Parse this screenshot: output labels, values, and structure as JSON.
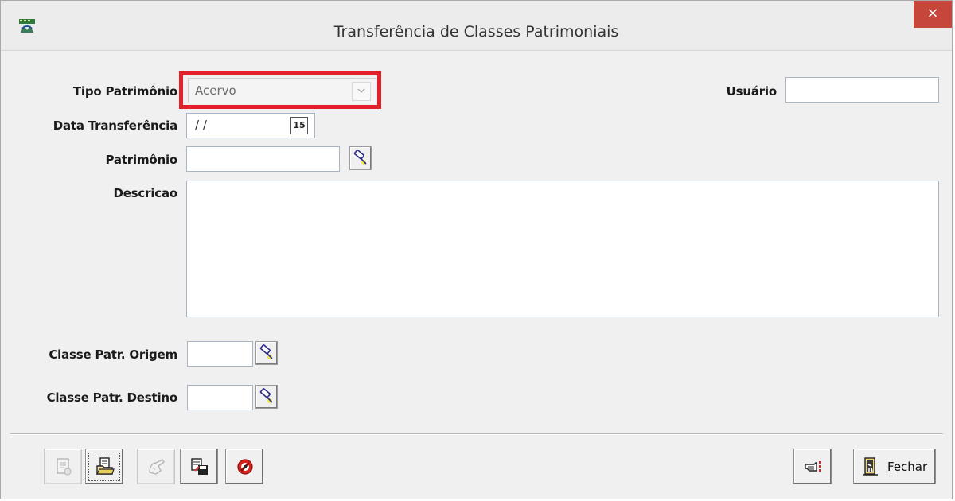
{
  "window": {
    "title": "Transferência de Classes Patrimoniais",
    "close_glyph": "×"
  },
  "form": {
    "tipo_patrimonio": {
      "label": "Tipo Patrimônio",
      "value": "Acervo"
    },
    "usuario": {
      "label": "Usuário",
      "value": ""
    },
    "data_transferencia": {
      "label": "Data Transferência",
      "value": "/ /"
    },
    "patrimonio": {
      "label": "Patrimônio",
      "value": ""
    },
    "descricao": {
      "label": "Descricao",
      "value": ""
    },
    "classe_origem": {
      "label": "Classe Patr. Origem",
      "value": ""
    },
    "classe_destino": {
      "label": "Classe Patr. Destino",
      "value": ""
    }
  },
  "toolbar": {
    "calendar_day": "15",
    "fechar_first": "F",
    "fechar_rest": "echar"
  },
  "icons": {
    "app": "app-logo-icon",
    "search": "flashlight-search-icon",
    "calendar": "calendar-icon",
    "new": "new-document-icon",
    "open": "folder-document-icon",
    "edit": "edit-hand-icon",
    "save": "save-icon",
    "cancel": "cancel-icon",
    "confirm": "pointing-hand-icon",
    "exit": "exit-door-icon"
  },
  "colors": {
    "highlight": "#e2202a",
    "close_button": "#c7463b",
    "window_bg": "#f0f0f0"
  }
}
